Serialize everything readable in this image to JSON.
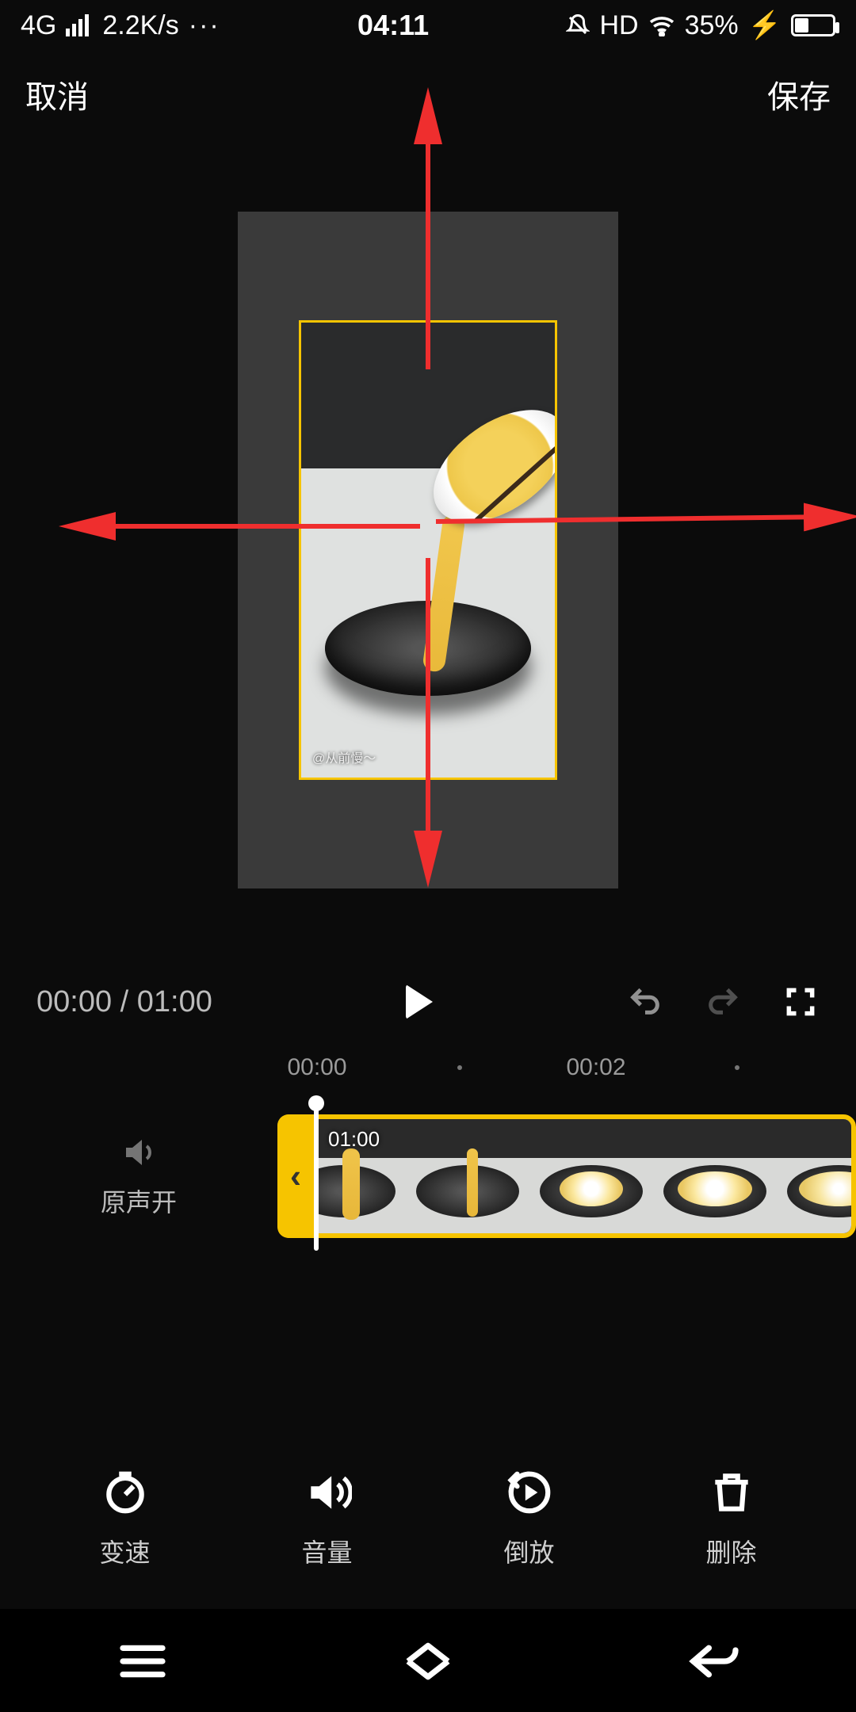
{
  "status": {
    "network": "4G",
    "speed": "2.2K/s",
    "more": "···",
    "clock": "04:11",
    "hd": "HD",
    "battery_pct": "35%",
    "charging": "⚡"
  },
  "header": {
    "cancel": "取消",
    "save": "保存"
  },
  "video_frame": {
    "watermark": "@从前慢～"
  },
  "transport": {
    "current": "00:00",
    "sep": " / ",
    "total": "01:00"
  },
  "ruler": {
    "t0": "00:00",
    "t1": "00:02"
  },
  "timeline": {
    "sound_label": "原声开",
    "clip_duration": "01:00",
    "handle_glyph": "‹"
  },
  "toolbar": {
    "speed": "变速",
    "volume": "音量",
    "reverse": "倒放",
    "delete": "删除"
  }
}
